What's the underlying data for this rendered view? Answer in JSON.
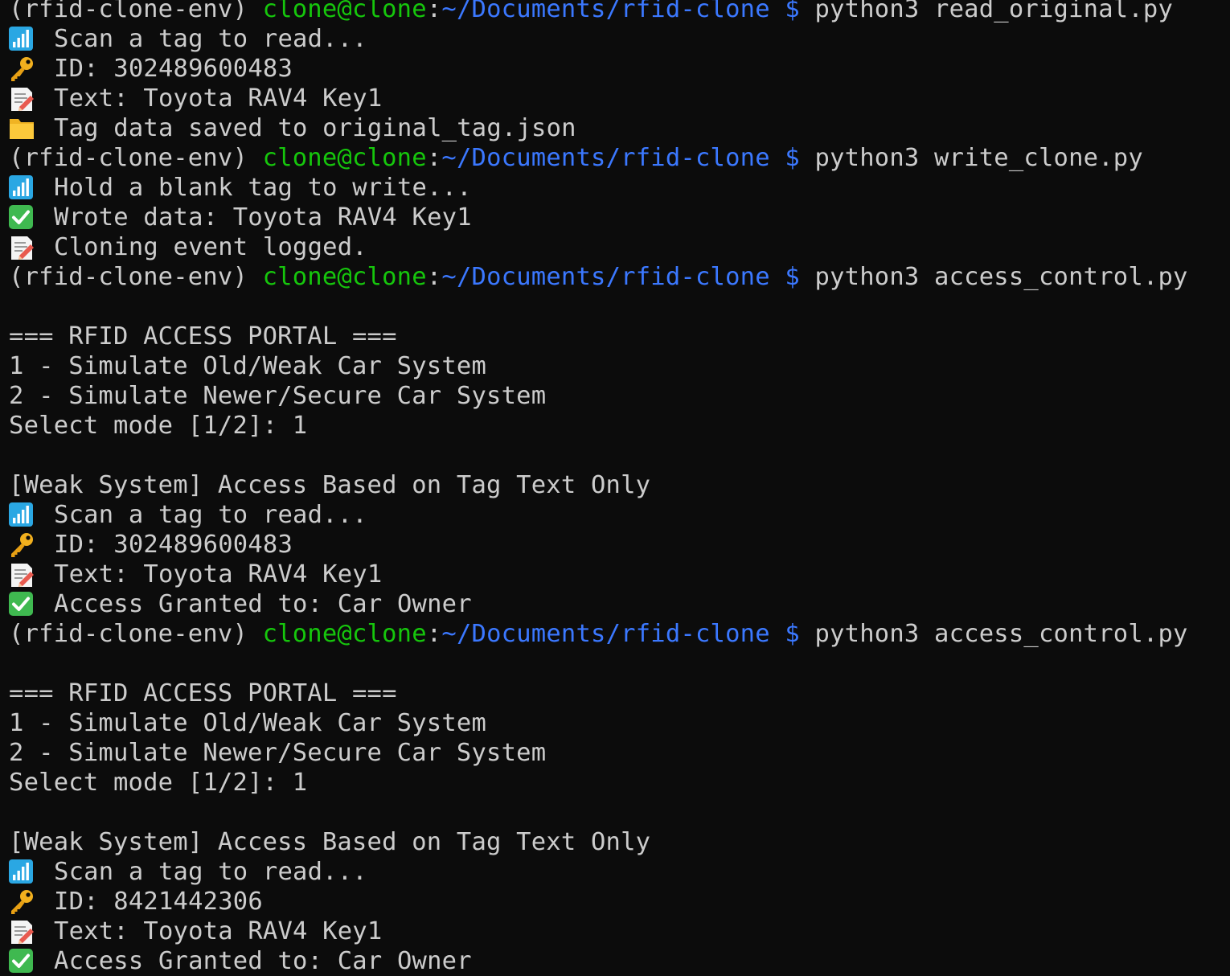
{
  "prompt": {
    "venv": "(rfid-clone-env)",
    "user_host": "clone@clone",
    "colon": ":",
    "path": "~/Documents/rfid-clone",
    "dollar": "$"
  },
  "colors": {
    "background": "#0c0c0c",
    "text": "#cccccc",
    "user_host": "#16c60c",
    "path": "#3b78ff"
  },
  "lines": [
    {
      "type": "prompt",
      "command": "python3 read_original.py"
    },
    {
      "type": "output",
      "icon": "signal-bars-icon",
      "text": "Scan a tag to read..."
    },
    {
      "type": "output",
      "icon": "key-icon",
      "text": "ID: 302489600483"
    },
    {
      "type": "output",
      "icon": "memo-icon",
      "text": "Text: Toyota RAV4 Key1"
    },
    {
      "type": "output",
      "icon": "folder-icon",
      "text": "Tag data saved to original_tag.json"
    },
    {
      "type": "prompt",
      "command": "python3 write_clone.py"
    },
    {
      "type": "output",
      "icon": "signal-bars-icon",
      "text": "Hold a blank tag to write..."
    },
    {
      "type": "output",
      "icon": "check-icon",
      "text": "Wrote data: Toyota RAV4 Key1"
    },
    {
      "type": "output",
      "icon": "memo-icon",
      "text": "Cloning event logged."
    },
    {
      "type": "prompt",
      "command": "python3 access_control.py"
    },
    {
      "type": "blank"
    },
    {
      "type": "plain",
      "text": "=== RFID ACCESS PORTAL ==="
    },
    {
      "type": "plain",
      "text": "1 - Simulate Old/Weak Car System"
    },
    {
      "type": "plain",
      "text": "2 - Simulate Newer/Secure Car System"
    },
    {
      "type": "plain",
      "text": "Select mode [1/2]: 1"
    },
    {
      "type": "blank"
    },
    {
      "type": "plain",
      "text": "[Weak System] Access Based on Tag Text Only"
    },
    {
      "type": "output",
      "icon": "signal-bars-icon",
      "text": "Scan a tag to read..."
    },
    {
      "type": "output",
      "icon": "key-icon",
      "text": "ID: 302489600483"
    },
    {
      "type": "output",
      "icon": "memo-icon",
      "text": "Text: Toyota RAV4 Key1"
    },
    {
      "type": "output",
      "icon": "check-icon",
      "text": "Access Granted to: Car Owner"
    },
    {
      "type": "prompt",
      "command": "python3 access_control.py"
    },
    {
      "type": "blank"
    },
    {
      "type": "plain",
      "text": "=== RFID ACCESS PORTAL ==="
    },
    {
      "type": "plain",
      "text": "1 - Simulate Old/Weak Car System"
    },
    {
      "type": "plain",
      "text": "2 - Simulate Newer/Secure Car System"
    },
    {
      "type": "plain",
      "text": "Select mode [1/2]: 1"
    },
    {
      "type": "blank"
    },
    {
      "type": "plain",
      "text": "[Weak System] Access Based on Tag Text Only"
    },
    {
      "type": "output",
      "icon": "signal-bars-icon",
      "text": "Scan a tag to read..."
    },
    {
      "type": "output",
      "icon": "key-icon",
      "text": "ID: 8421442306"
    },
    {
      "type": "output",
      "icon": "memo-icon",
      "text": "Text: Toyota RAV4 Key1"
    },
    {
      "type": "output",
      "icon": "check-icon",
      "text": "Access Granted to: Car Owner"
    }
  ]
}
